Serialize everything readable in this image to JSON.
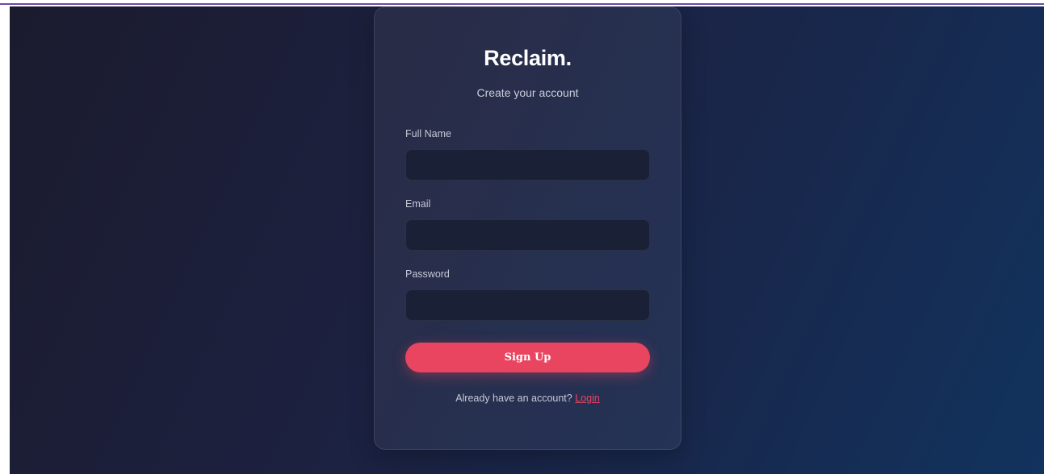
{
  "app": {
    "logo": "Reclaim.",
    "subtitle": "Create your account"
  },
  "form": {
    "full_name": {
      "label": "Full Name",
      "value": "",
      "placeholder": ""
    },
    "email": {
      "label": "Email",
      "value": "",
      "placeholder": ""
    },
    "password": {
      "label": "Password",
      "value": "",
      "placeholder": ""
    },
    "submit_label": "Sign Up"
  },
  "footer": {
    "prompt": "Already have an account?",
    "link_label": "Login"
  },
  "colors": {
    "accent": "#e94560",
    "background_start": "#1b1b2e",
    "background_end": "#11335e",
    "input_bg": "#1a2035"
  }
}
